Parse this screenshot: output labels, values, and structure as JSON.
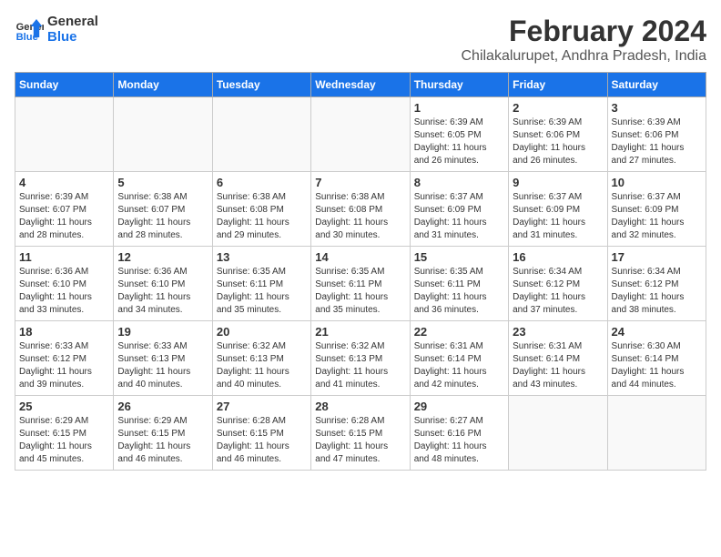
{
  "header": {
    "logo_line1": "General",
    "logo_line2": "Blue",
    "month": "February 2024",
    "location": "Chilakalurupet, Andhra Pradesh, India"
  },
  "weekdays": [
    "Sunday",
    "Monday",
    "Tuesday",
    "Wednesday",
    "Thursday",
    "Friday",
    "Saturday"
  ],
  "weeks": [
    [
      {
        "day": "",
        "info": ""
      },
      {
        "day": "",
        "info": ""
      },
      {
        "day": "",
        "info": ""
      },
      {
        "day": "",
        "info": ""
      },
      {
        "day": "1",
        "info": "Sunrise: 6:39 AM\nSunset: 6:05 PM\nDaylight: 11 hours\nand 26 minutes."
      },
      {
        "day": "2",
        "info": "Sunrise: 6:39 AM\nSunset: 6:06 PM\nDaylight: 11 hours\nand 26 minutes."
      },
      {
        "day": "3",
        "info": "Sunrise: 6:39 AM\nSunset: 6:06 PM\nDaylight: 11 hours\nand 27 minutes."
      }
    ],
    [
      {
        "day": "4",
        "info": "Sunrise: 6:39 AM\nSunset: 6:07 PM\nDaylight: 11 hours\nand 28 minutes."
      },
      {
        "day": "5",
        "info": "Sunrise: 6:38 AM\nSunset: 6:07 PM\nDaylight: 11 hours\nand 28 minutes."
      },
      {
        "day": "6",
        "info": "Sunrise: 6:38 AM\nSunset: 6:08 PM\nDaylight: 11 hours\nand 29 minutes."
      },
      {
        "day": "7",
        "info": "Sunrise: 6:38 AM\nSunset: 6:08 PM\nDaylight: 11 hours\nand 30 minutes."
      },
      {
        "day": "8",
        "info": "Sunrise: 6:37 AM\nSunset: 6:09 PM\nDaylight: 11 hours\nand 31 minutes."
      },
      {
        "day": "9",
        "info": "Sunrise: 6:37 AM\nSunset: 6:09 PM\nDaylight: 11 hours\nand 31 minutes."
      },
      {
        "day": "10",
        "info": "Sunrise: 6:37 AM\nSunset: 6:09 PM\nDaylight: 11 hours\nand 32 minutes."
      }
    ],
    [
      {
        "day": "11",
        "info": "Sunrise: 6:36 AM\nSunset: 6:10 PM\nDaylight: 11 hours\nand 33 minutes."
      },
      {
        "day": "12",
        "info": "Sunrise: 6:36 AM\nSunset: 6:10 PM\nDaylight: 11 hours\nand 34 minutes."
      },
      {
        "day": "13",
        "info": "Sunrise: 6:35 AM\nSunset: 6:11 PM\nDaylight: 11 hours\nand 35 minutes."
      },
      {
        "day": "14",
        "info": "Sunrise: 6:35 AM\nSunset: 6:11 PM\nDaylight: 11 hours\nand 35 minutes."
      },
      {
        "day": "15",
        "info": "Sunrise: 6:35 AM\nSunset: 6:11 PM\nDaylight: 11 hours\nand 36 minutes."
      },
      {
        "day": "16",
        "info": "Sunrise: 6:34 AM\nSunset: 6:12 PM\nDaylight: 11 hours\nand 37 minutes."
      },
      {
        "day": "17",
        "info": "Sunrise: 6:34 AM\nSunset: 6:12 PM\nDaylight: 11 hours\nand 38 minutes."
      }
    ],
    [
      {
        "day": "18",
        "info": "Sunrise: 6:33 AM\nSunset: 6:12 PM\nDaylight: 11 hours\nand 39 minutes."
      },
      {
        "day": "19",
        "info": "Sunrise: 6:33 AM\nSunset: 6:13 PM\nDaylight: 11 hours\nand 40 minutes."
      },
      {
        "day": "20",
        "info": "Sunrise: 6:32 AM\nSunset: 6:13 PM\nDaylight: 11 hours\nand 40 minutes."
      },
      {
        "day": "21",
        "info": "Sunrise: 6:32 AM\nSunset: 6:13 PM\nDaylight: 11 hours\nand 41 minutes."
      },
      {
        "day": "22",
        "info": "Sunrise: 6:31 AM\nSunset: 6:14 PM\nDaylight: 11 hours\nand 42 minutes."
      },
      {
        "day": "23",
        "info": "Sunrise: 6:31 AM\nSunset: 6:14 PM\nDaylight: 11 hours\nand 43 minutes."
      },
      {
        "day": "24",
        "info": "Sunrise: 6:30 AM\nSunset: 6:14 PM\nDaylight: 11 hours\nand 44 minutes."
      }
    ],
    [
      {
        "day": "25",
        "info": "Sunrise: 6:29 AM\nSunset: 6:15 PM\nDaylight: 11 hours\nand 45 minutes."
      },
      {
        "day": "26",
        "info": "Sunrise: 6:29 AM\nSunset: 6:15 PM\nDaylight: 11 hours\nand 46 minutes."
      },
      {
        "day": "27",
        "info": "Sunrise: 6:28 AM\nSunset: 6:15 PM\nDaylight: 11 hours\nand 46 minutes."
      },
      {
        "day": "28",
        "info": "Sunrise: 6:28 AM\nSunset: 6:15 PM\nDaylight: 11 hours\nand 47 minutes."
      },
      {
        "day": "29",
        "info": "Sunrise: 6:27 AM\nSunset: 6:16 PM\nDaylight: 11 hours\nand 48 minutes."
      },
      {
        "day": "",
        "info": ""
      },
      {
        "day": "",
        "info": ""
      }
    ]
  ]
}
